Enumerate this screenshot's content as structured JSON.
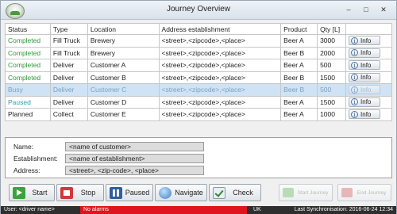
{
  "window": {
    "title": "Journey Overview",
    "controls": {
      "minimize": "–",
      "maximize": "□",
      "close": "✕"
    }
  },
  "table": {
    "headers": [
      "Status",
      "Type",
      "Location",
      "Address establishment",
      "Product",
      "Qty [L]",
      ""
    ],
    "info_label": "Info",
    "rows": [
      {
        "status": "Completed",
        "type": "Fill Truck",
        "location": "Brewery",
        "address": "<street>,<zipcode>,<place>",
        "product": "Beer A",
        "qty": "3000"
      },
      {
        "status": "Completed",
        "type": "Fill Truck",
        "location": "Brewery",
        "address": "<street>,<zipcode>,<place>",
        "product": "Beer B",
        "qty": "2000"
      },
      {
        "status": "Completed",
        "type": "Deliver",
        "location": "Customer A",
        "address": "<street>,<zipcode>,<place>",
        "product": "Beer A",
        "qty": "500"
      },
      {
        "status": "Completed",
        "type": "Deliver",
        "location": "Customer B",
        "address": "<street>,<zipcode>,<place>",
        "product": "Beer B",
        "qty": "1500"
      },
      {
        "status": "Busy",
        "type": "Deliver",
        "location": "Customer C",
        "address": "<street>,<zipcode>,<place>",
        "product": "Beer B",
        "qty": "500"
      },
      {
        "status": "Paused",
        "type": "Deliver",
        "location": "Customer D",
        "address": "<street>,<zipcode>,<place>",
        "product": "Beer A",
        "qty": "1500"
      },
      {
        "status": "Planned",
        "type": "Collect",
        "location": "Customer E",
        "address": "<street>,<zipcode>,<place>",
        "product": "Beer A",
        "qty": "1000"
      }
    ]
  },
  "detail": {
    "name_label": "Name:",
    "name_value": "<name of customer>",
    "establishment_label": "Establishment:",
    "establishment_value": "<name of establishment>",
    "address_label": "Address:",
    "address_value": "<street>, <zip-code>, <place>"
  },
  "actions": {
    "start": "Start",
    "stop": "Stop",
    "paused": "Paused",
    "navigate": "Navigate",
    "check": "Check",
    "start_journey": "Start Journey",
    "end_journey": "End Journey"
  },
  "statusbar": {
    "user": "User: <driver name>",
    "alarms": "No alarms",
    "language": "UK",
    "sync": "Last Synchronisation: 2016-06-24 12:34"
  },
  "colors": {
    "completed": "#2e9a3a",
    "paused": "#2aa0b8",
    "busy_row": "#cfe3f5",
    "alarm_bar": "#e0141e"
  }
}
